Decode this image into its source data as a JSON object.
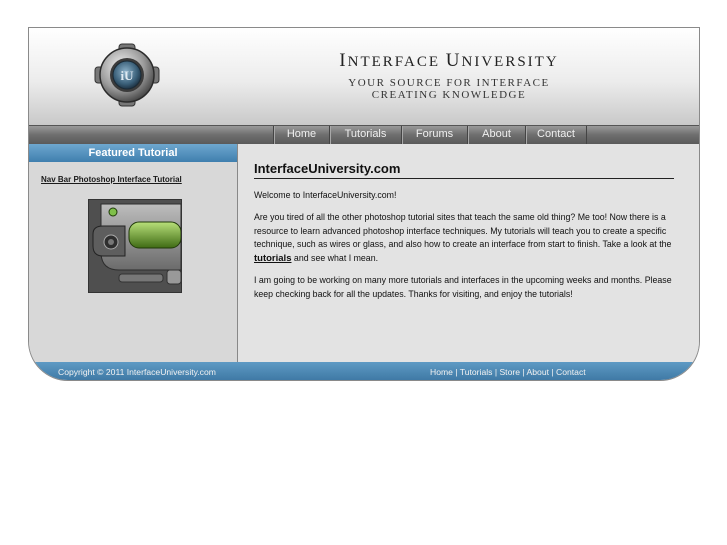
{
  "header": {
    "title_cap1": "I",
    "title_word1": "NTERFACE",
    "title_cap2": "U",
    "title_word2": "NIVERSITY",
    "tagline_line1": "YOUR SOURCE FOR INTERFACE",
    "tagline_line2": "CREATING KNOWLEDGE"
  },
  "nav": {
    "items": [
      {
        "label": "Home"
      },
      {
        "label": "Tutorials"
      },
      {
        "label": "Forums"
      },
      {
        "label": "About"
      },
      {
        "label": "Contact"
      }
    ]
  },
  "sidebar": {
    "heading": "Featured Tutorial",
    "featured_link": "Nav Bar Photoshop Interface Tutorial",
    "thumbnail_icon": "nav-bar-preview-image"
  },
  "main": {
    "title": "InterfaceUniversity.com",
    "welcome": "Welcome to InterfaceUniversity.com!",
    "para1_before": "Are you tired of all the other photoshop tutorial sites that teach the same old thing? Me too! Now there is a resource to learn advanced photoshop interface techniques. My tutorials will teach you to create a specific technique, such as wires or glass, and also how to create an interface from start to finish. Take a look at the ",
    "para1_link": "tutorials",
    "para1_after": " and see what I mean.",
    "para2": "I am going to be working on many more tutorials and interfaces in the upcoming weeks and months. Please keep checking back for all the updates. Thanks for visiting, and enjoy the tutorials!"
  },
  "footer": {
    "copyright": "Copyright © 2011 InterfaceUniversity.com",
    "links": [
      {
        "label": "Home"
      },
      {
        "label": "Tutorials"
      },
      {
        "label": "Store"
      },
      {
        "label": "About"
      },
      {
        "label": "Contact"
      }
    ],
    "separator": " | "
  },
  "colors": {
    "accent_blue": "#4a88b7",
    "nav_gray": "#6e6e6e",
    "panel_gray": "#d8d8d8"
  }
}
